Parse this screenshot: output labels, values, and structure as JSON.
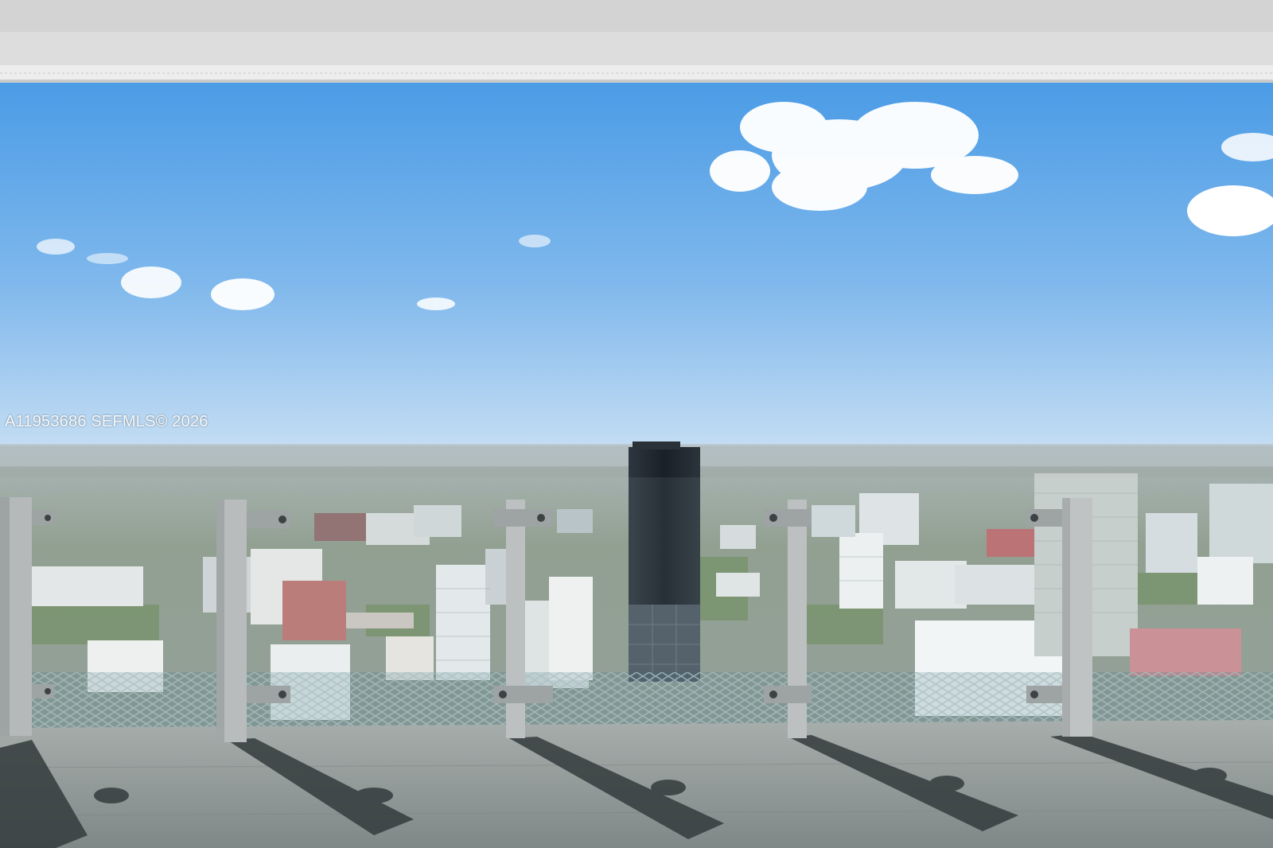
{
  "photo": {
    "watermark": "A11953686  SEFMLS© 2026",
    "palette": {
      "sky_top": "#4a9be6",
      "sky_horizon": "#c4ddf3",
      "cloud": "#ffffff",
      "city": "#9aa79a",
      "glass_tower": "#222a33",
      "deck_floor": "#8f9897",
      "shadow": "#333a3b",
      "post": "#b9bcbd",
      "ceiling": "#dcdddc"
    }
  }
}
